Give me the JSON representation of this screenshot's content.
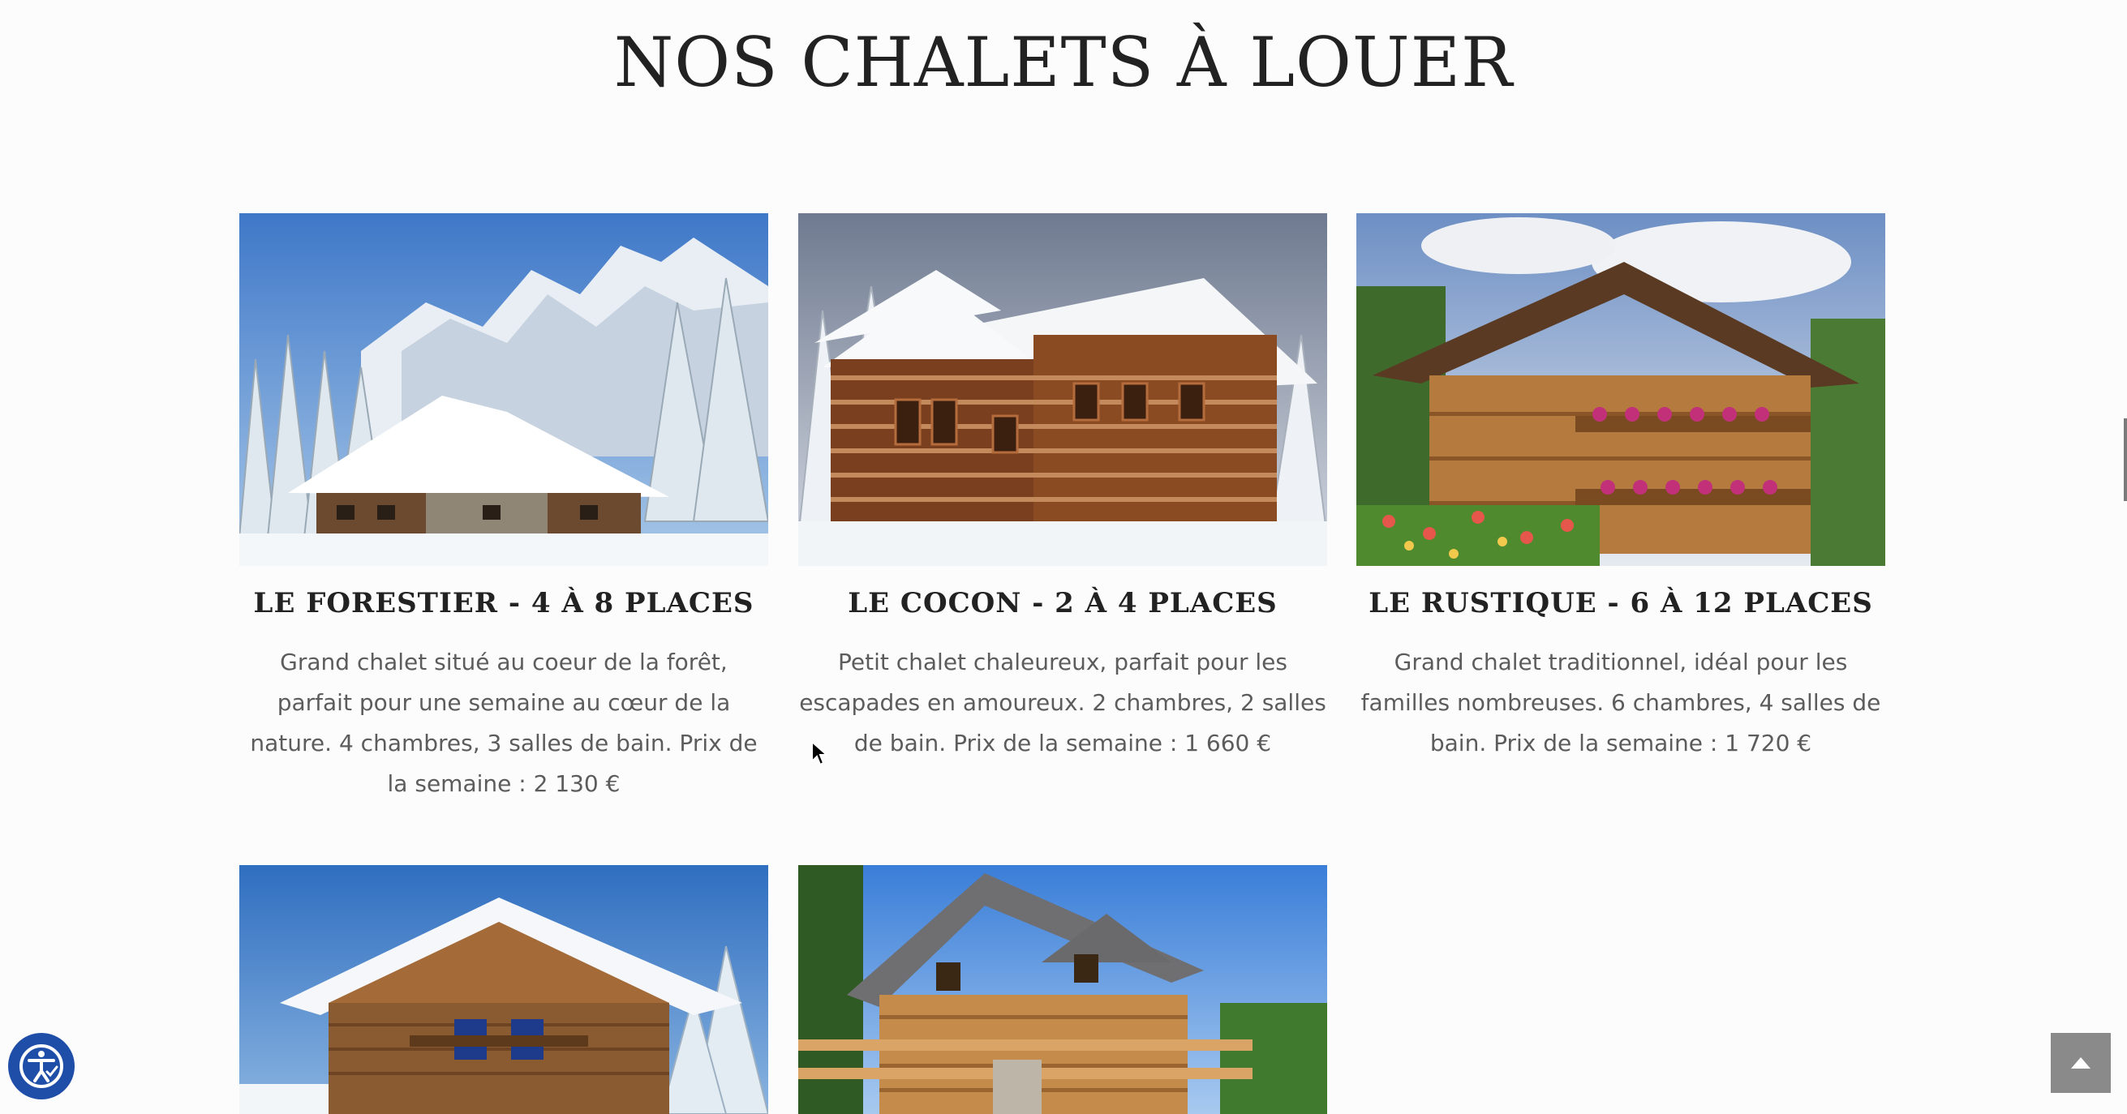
{
  "page": {
    "title": "NOS CHALETS À LOUER"
  },
  "chalets": [
    {
      "title": "LE FORESTIER - 4 À 8 PLACES",
      "description": "Grand chalet situé au coeur de la forêt, parfait pour une semaine au cœur de la nature. 4 chambres, 3 salles de bain. Prix de la semaine : 2 130 €",
      "image": "snowy-chalet-mountains"
    },
    {
      "title": "LE COCON - 2 À 4 PLACES",
      "description": "Petit chalet chaleureux, parfait pour les escapades en amoureux. 2 chambres, 2 salles de bain. Prix de la semaine : 1 660 €",
      "image": "log-chalet-snow"
    },
    {
      "title": "LE RUSTIQUE - 6 À 12 PLACES",
      "description": "Grand chalet traditionnel, idéal pour les familles nombreuses. 6 chambres, 4 salles de bain. Prix de la semaine : 1 720 €",
      "image": "flowered-chalet-summer"
    },
    {
      "image": "alpine-chalet-snow-roof"
    },
    {
      "image": "log-cabin-summer"
    }
  ],
  "widgets": {
    "accessibility_icon": "accessibility-icon",
    "back_to_top_icon": "chevron-up-icon"
  },
  "colors": {
    "accessibility": "#1f4ea8",
    "back_to_top": "#8a8a8a",
    "title": "#222222",
    "text": "#5c5c5c"
  }
}
